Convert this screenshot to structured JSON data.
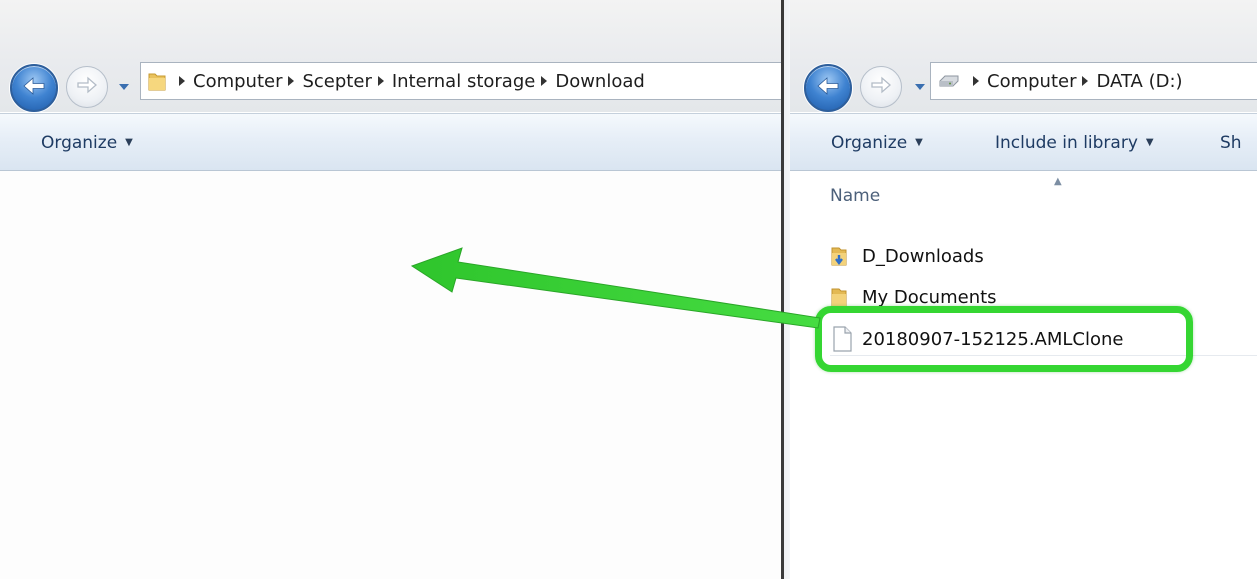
{
  "left_window": {
    "breadcrumbs": [
      "Computer",
      "Scepter",
      "Internal storage",
      "Download"
    ],
    "location_icon": "folder-icon",
    "toolbar": {
      "organize": "Organize"
    }
  },
  "right_window": {
    "breadcrumbs": [
      "Computer",
      "DATA (D:)"
    ],
    "location_icon": "drive-icon",
    "toolbar": {
      "organize": "Organize",
      "include_in_library": "Include in library",
      "share_partial": "Sh"
    },
    "column_header": "Name",
    "items": [
      {
        "name": "D_Downloads",
        "icon": "downloads-folder-icon"
      },
      {
        "name": "My Documents",
        "icon": "folder-icon"
      },
      {
        "name": "20180907-152125.AMLClone",
        "icon": "file-icon"
      }
    ]
  },
  "annotations": {
    "highlight_color": "#35d632",
    "arrow_color": "#39d138"
  }
}
